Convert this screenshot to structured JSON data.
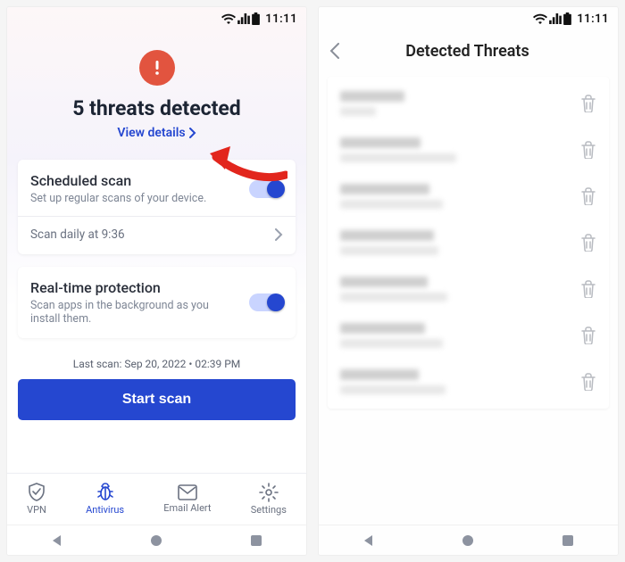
{
  "status": {
    "time": "11:11"
  },
  "left": {
    "hero_title": "5 threats detected",
    "view_details": "View details",
    "scheduled": {
      "title": "Scheduled scan",
      "sub": "Set up regular scans of your device.",
      "time_line": "Scan daily at 9:36"
    },
    "realtime": {
      "title": "Real-time protection",
      "sub": "Scan apps in the background as you install them."
    },
    "last_scan": "Last scan: Sep 20, 2022 • 02:39 PM",
    "scan_button": "Start scan",
    "nav": {
      "vpn": "VPN",
      "antivirus": "Antivirus",
      "email": "Email Alert",
      "settings": "Settings"
    }
  },
  "right": {
    "title": "Detected Threats"
  },
  "colors": {
    "accent": "#2547d0",
    "alert": "#e2543f"
  }
}
